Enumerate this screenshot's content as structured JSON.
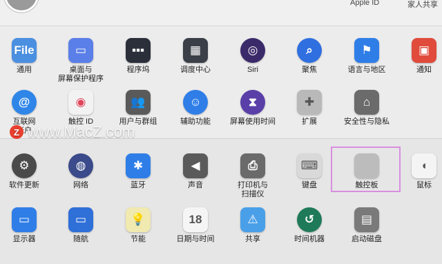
{
  "header": {
    "apple_id_label": "Apple ID",
    "family_sharing_label": "家人共享"
  },
  "row1": [
    {
      "label": "通用",
      "icon": "general-icon",
      "glyph": "File",
      "color": "#4a8fe0"
    },
    {
      "label": "桌面与\n屏幕保护程序",
      "icon": "desktop-screensaver-icon",
      "glyph": "▭",
      "color": "#5b7fe8"
    },
    {
      "label": "程序坞",
      "icon": "dock-icon",
      "glyph": "▪▪▪",
      "color": "#2a2f3a"
    },
    {
      "label": "调度中心",
      "icon": "mission-control-icon",
      "glyph": "▦",
      "color": "#3a3f48"
    },
    {
      "label": "Siri",
      "icon": "siri-icon",
      "glyph": "◎",
      "color": "#3b2a6a"
    },
    {
      "label": "聚焦",
      "icon": "spotlight-icon",
      "glyph": "⌕",
      "color": "#2f6fe0"
    },
    {
      "label": "语言与地区",
      "icon": "language-region-icon",
      "glyph": "⚑",
      "color": "#2f7ee8"
    },
    {
      "label": "通知",
      "icon": "notifications-icon",
      "glyph": "▣",
      "color": "#e04b3c"
    }
  ],
  "row2": [
    {
      "label": "互联网\n帐户",
      "icon": "internet-accounts-icon",
      "glyph": "@",
      "color": "#2f86e8"
    },
    {
      "label": "触控 ID",
      "icon": "touch-id-icon",
      "glyph": "◉",
      "color": "#f2f2f2"
    },
    {
      "label": "用户与群组",
      "icon": "users-groups-icon",
      "glyph": "👥",
      "color": "#5a5a5a"
    },
    {
      "label": "辅助功能",
      "icon": "accessibility-icon",
      "glyph": "☺",
      "color": "#2f7ee8"
    },
    {
      "label": "屏幕使用时间",
      "icon": "screen-time-icon",
      "glyph": "⧗",
      "color": "#5a3fa8"
    },
    {
      "label": "扩展",
      "icon": "extensions-icon",
      "glyph": "✚",
      "color": "#b9b9b9"
    },
    {
      "label": "安全性与隐私",
      "icon": "security-privacy-icon",
      "glyph": "⌂",
      "color": "#6b6b6b"
    }
  ],
  "row3": [
    {
      "label": "软件更新",
      "icon": "software-update-icon",
      "glyph": "⚙",
      "color": "#4a4a4a"
    },
    {
      "label": "网络",
      "icon": "network-icon",
      "glyph": "◍",
      "color": "#3a4a8a"
    },
    {
      "label": "蓝牙",
      "icon": "bluetooth-icon",
      "glyph": "✱",
      "color": "#2f7ee8"
    },
    {
      "label": "声音",
      "icon": "sound-icon",
      "glyph": "◀",
      "color": "#5a5a5a"
    },
    {
      "label": "打印机与\n扫描仪",
      "icon": "printers-scanners-icon",
      "glyph": "⎙",
      "color": "#6a6a6a"
    },
    {
      "label": "键盘",
      "icon": "keyboard-icon",
      "glyph": "⌨",
      "color": "#d9d9d9"
    },
    {
      "label": "触控板",
      "icon": "trackpad-icon",
      "glyph": "",
      "color": "#bcbcbc"
    },
    {
      "label": "鼠标",
      "icon": "mouse-icon",
      "glyph": "◖",
      "color": "#f4f4f4"
    }
  ],
  "row4": [
    {
      "label": "显示器",
      "icon": "displays-icon",
      "glyph": "▭",
      "color": "#2f7ee8"
    },
    {
      "label": "随航",
      "icon": "sidecar-icon",
      "glyph": "▭",
      "color": "#2f6fd8"
    },
    {
      "label": "节能",
      "icon": "energy-saver-icon",
      "glyph": "💡",
      "color": "#f0e9b0"
    },
    {
      "label": "日期与时间",
      "icon": "date-time-icon",
      "glyph": "18",
      "color": "#f5f5f5"
    },
    {
      "label": "共享",
      "icon": "sharing-icon",
      "glyph": "⚠",
      "color": "#4aa0e8"
    },
    {
      "label": "时间机器",
      "icon": "time-machine-icon",
      "glyph": "↺",
      "color": "#1f7a5a"
    },
    {
      "label": "启动磁盘",
      "icon": "startup-disk-icon",
      "glyph": "▤",
      "color": "#7a7a7a"
    }
  ],
  "watermark": {
    "text": "www.MacZ.com",
    "logo": "Z"
  }
}
